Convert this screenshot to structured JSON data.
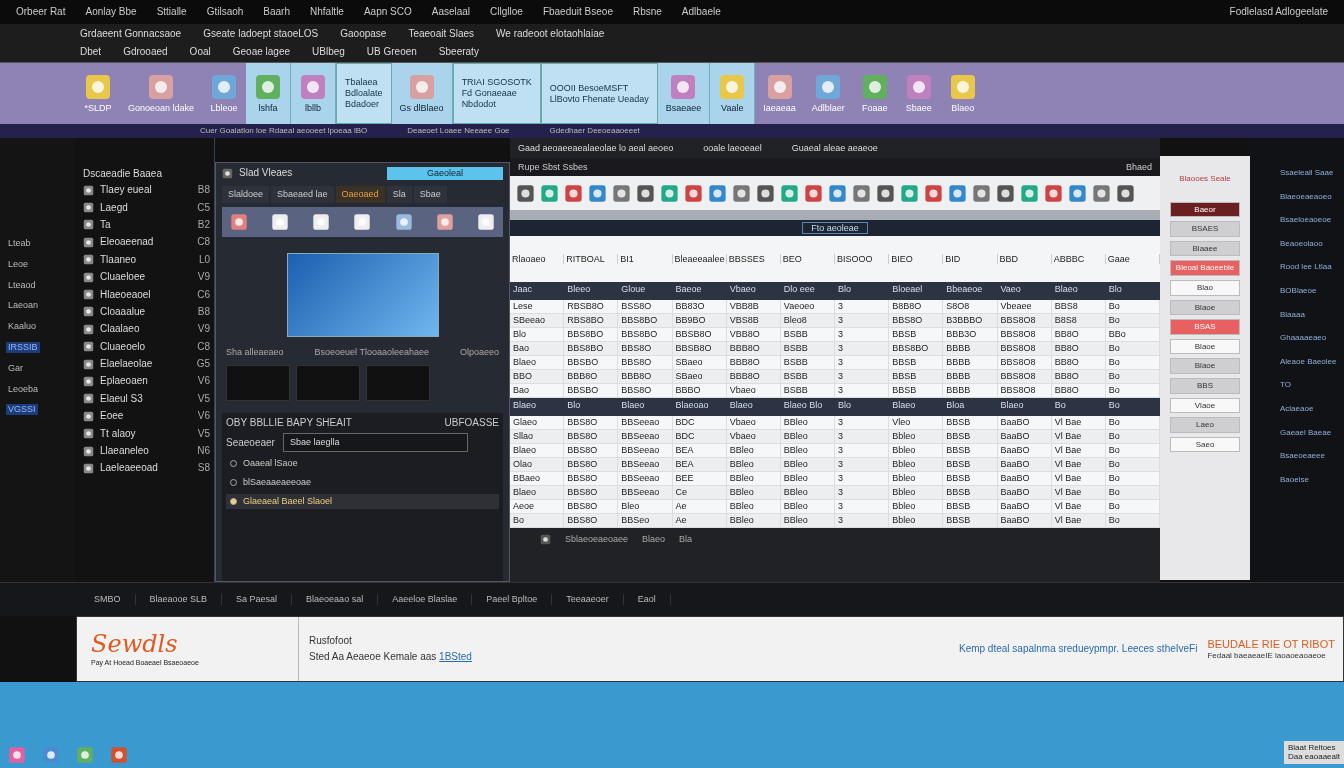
{
  "menu_bar": {
    "items": [
      "Orbeer Rat",
      "Aonlay Bbe",
      "Sttialle",
      "Gtilsaoh",
      "Baarh",
      "Nhfaltle",
      "Aapn SCO",
      "Aaselaal",
      "Cllglloe",
      "Fbaeduit Bseoe",
      "Rbsne",
      "Adlbaele"
    ],
    "right_text": "Fodlelasd Adlogeelate"
  },
  "toolbar": {
    "row_1": [
      "Grdaeent Gonnacsaoe",
      "Gseate ladoept staoeLOS",
      "Gaoopase",
      "Teaeoait Slaes",
      "We radeoot elotaohlaiae"
    ],
    "row_2": [
      "Dbet",
      "Gdrooaed",
      "Ooal",
      "Geoae lagee",
      "UBlbeg",
      "UB Greoen",
      "Sbeeraty"
    ]
  },
  "ribbon": {
    "items": [
      {
        "kind": "button",
        "highlighted": false,
        "label": "*SLDP"
      },
      {
        "kind": "button",
        "highlighted": false,
        "label": "Gonoeoan ldake"
      },
      {
        "kind": "button",
        "highlighted": false,
        "label": "Lbleoe"
      },
      {
        "kind": "button",
        "highlighted": true,
        "label": "lshfa"
      },
      {
        "kind": "button",
        "highlighted": true,
        "label": "lbllb"
      },
      {
        "kind": "note",
        "highlighted": true,
        "lines": [
          "Tbalaea",
          "Bdloalate",
          "Bdadoer"
        ]
      },
      {
        "kind": "button",
        "highlighted": true,
        "label": "Gs dlBlaeo"
      },
      {
        "kind": "note",
        "highlighted": true,
        "lines": [
          "TRIAI SGOSOTK",
          "Fd Gonaeaae",
          "Nbdodot"
        ]
      },
      {
        "kind": "note",
        "highlighted": true,
        "lines": [
          "OOOII BesoeMSFT",
          "LlBovto Fhenate Ueaday"
        ]
      },
      {
        "kind": "button",
        "highlighted": true,
        "label": "Bsaeaee"
      },
      {
        "kind": "button",
        "highlighted": true,
        "label": "Vaale"
      },
      {
        "kind": "button",
        "highlighted": false,
        "label": "Iaeaeaa"
      },
      {
        "kind": "button",
        "highlighted": false,
        "label": "Adlblaer"
      },
      {
        "kind": "button",
        "highlighted": false,
        "label": "Foaae"
      },
      {
        "kind": "button",
        "highlighted": false,
        "label": "Sbaee"
      },
      {
        "kind": "button",
        "highlighted": false,
        "label": "Blaeo"
      }
    ],
    "footer": [
      "Cuer Goalatlon loe Rdaeal aeooeet lpoeaa lBO",
      "Deaeoet Loaee Neeaee Goe",
      "Gdedhaer Deeoeaaoeeet"
    ]
  },
  "sidebar": {
    "items": [
      {
        "label": "Lteab",
        "selected": false
      },
      {
        "label": "Leoe",
        "selected": false
      },
      {
        "label": "Lteaod",
        "selected": false
      },
      {
        "label": "Laeoan",
        "selected": false
      },
      {
        "label": "Kaaluo",
        "selected": false
      },
      {
        "label": "IRSSIB",
        "selected": true
      },
      {
        "label": "Gar",
        "selected": false
      },
      {
        "label": "Leoeba",
        "selected": false
      },
      {
        "label": "VGSSI",
        "selected": true
      }
    ]
  },
  "file_list": {
    "header": "Dscaeadie Baaea",
    "items": [
      {
        "label": "Tlaey eueal",
        "code": "B8"
      },
      {
        "label": "Laegd",
        "code": "C5"
      },
      {
        "label": "Ta",
        "code": "B2"
      },
      {
        "label": "Eleoaeenad",
        "code": "C8"
      },
      {
        "label": "Tlaaneo",
        "code": "L0"
      },
      {
        "label": "Cluaeloee",
        "code": "V9"
      },
      {
        "label": "Hlaeoeaoel",
        "code": "C6"
      },
      {
        "label": "Cloaaalue",
        "code": "B8"
      },
      {
        "label": "Claalaeo",
        "code": "V9"
      },
      {
        "label": "Cluaeoelo",
        "code": "C8"
      },
      {
        "label": "Elaelaeolae",
        "code": "G5"
      },
      {
        "label": "Eplaeoaen",
        "code": "V6"
      },
      {
        "label": "Elaeul S3",
        "code": "V5"
      },
      {
        "label": "Eoee",
        "code": "V6"
      },
      {
        "label": "Tt alaoy",
        "code": "V5"
      },
      {
        "label": "Llaeaneleo",
        "code": "N6"
      },
      {
        "label": "Laeleaeeoad",
        "code": "S8"
      }
    ]
  },
  "dialog": {
    "title": "Slad Vleaes",
    "field": "Gaeoleal",
    "tabs": [
      {
        "label": "Slaldoee",
        "selected": false
      },
      {
        "label": "Sbaeaed lae",
        "selected": false
      },
      {
        "label": "Oaeoaed",
        "selected": true
      },
      {
        "label": "Sla",
        "selected": false
      },
      {
        "label": "Sbae",
        "selected": false
      }
    ],
    "caption": "Sha alleaeaeo",
    "info": "Bsoeoeuel Tlooaaoleeahaee",
    "info_right": "Olpoaeeo",
    "section_title": "OBY BBLLIE BAPY SHEAIT",
    "section_right": "UBFOASSE",
    "input_label": "Seaeoeaer",
    "input_value": "Sbae laeglla",
    "options": [
      {
        "label": "Oaaeal lSaoe",
        "selected": false
      },
      {
        "label": "blSaeaaeaeeoae",
        "selected": false
      },
      {
        "label": "Glaeaeal Baeel Slaoel",
        "selected": true
      }
    ]
  },
  "sheet": {
    "top_left": "Gaad aeoaeeaealaeolae lo aeal aeoeo",
    "top_mid": "ooale laeoeael",
    "top_right": "Guaeal aleae aeaeoe",
    "title": "Rupe Sbst Ssbes",
    "title_right": "Bhaed",
    "banner": "Fto aeoleae",
    "summary": [
      "Rlaoaeo",
      "RITBOAL",
      "BI1",
      "Bleaeeaalee",
      "BBSSES",
      "BEO",
      "BISOOO",
      "BIEO",
      "BID",
      "BBD",
      "ABBBC",
      "Gaae"
    ],
    "columns": [
      "Jaac",
      "Bleeo",
      "Gloue",
      "Baeoe",
      "Vbaeo",
      "Dlo eee",
      "Blo",
      "Bloeael",
      "Bbeaeoe",
      "Vaeo",
      "Blaeo",
      "Blo"
    ],
    "rows": [
      [
        "Lese",
        "RBSB8O",
        "BSS8O",
        "BB83O",
        "VBB8B",
        "Vaeoeo",
        "3",
        "B8B8O",
        "S8O8",
        "Vbeaee",
        "BBS8",
        "Bo"
      ],
      [
        "SBeeao",
        "RBS8BO",
        "BBS8BO",
        "BB9BO",
        "VBS8B",
        "Bleo8",
        "3",
        "BBS8O",
        "B3BBBO",
        "BBS8O8",
        "B8S8",
        "Bo"
      ],
      [
        "Blo",
        "BBS8BO",
        "BBS8BO",
        "BBSB8O",
        "VBB8O",
        "BSBB",
        "3",
        "BBSB",
        "BBB3O",
        "BBS8O8",
        "BB8O",
        "BBo"
      ],
      [
        "Bao",
        "BBS8BO",
        "BBS8O",
        "BBSB8O",
        "BBB8O",
        "BSBB",
        "3",
        "BBS8BO",
        "BBBB",
        "BBS8O8",
        "BB8O",
        "Bo"
      ],
      [
        "Blaeo",
        "BBSBO",
        "BBS8O",
        "SBaeo",
        "BBB8O",
        "BSBB",
        "3",
        "BBSB",
        "BBBB",
        "BBS8O8",
        "BB8O",
        "Bo"
      ],
      [
        "BBO",
        "BBB8O",
        "BBB8O",
        "SBaeo",
        "BBB8O",
        "BSBB",
        "3",
        "BBSB",
        "BBBB",
        "BBS8O8",
        "BB8O",
        "Bo"
      ],
      [
        "Bao",
        "BBSBO",
        "BBS8O",
        "BBBO",
        "Vbaeo",
        "BSBB",
        "3",
        "BBSB",
        "BBBB",
        "BBS8O8",
        "BB8O",
        "Bo"
      ]
    ],
    "subheader": [
      "Blaeo",
      "Blo",
      "Blaeo",
      "Blaeoao",
      "Blaeo",
      "Blaeo Blo",
      "Blo",
      "Blaeo",
      "Bloa",
      "Blaeo",
      "Bo",
      "Bo"
    ],
    "rows_2": [
      [
        "Glaeo",
        "BBS8O",
        "BBSeeao",
        "BDC",
        "Vbaeo",
        "BBleo",
        "3",
        "Vleo",
        "BBSB",
        "BaaBO",
        "Vl Bae",
        "Bo"
      ],
      [
        "Sllao",
        "BBS8O",
        "BBSeeao",
        "BDC",
        "Vbaeo",
        "BBleo",
        "3",
        "Bbleo",
        "BBSB",
        "BaaBO",
        "Vl Bae",
        "Bo"
      ],
      [
        "Blaeo",
        "BBS8O",
        "BBSeeao",
        "BEA",
        "BBleo",
        "BBleo",
        "3",
        "Bbleo",
        "BBSB",
        "BaaBO",
        "Vl Bae",
        "Bo"
      ],
      [
        "Olao",
        "BBS8O",
        "BBSeeao",
        "BEA",
        "BBleo",
        "BBleo",
        "3",
        "Bbleo",
        "BBSB",
        "BaaBO",
        "Vl Bae",
        "Bo"
      ],
      [
        "BBaeo",
        "BBS8O",
        "BBSeeao",
        "BEE",
        "BBleo",
        "BBleo",
        "3",
        "Bbleo",
        "BBSB",
        "BaaBO",
        "Vl Bae",
        "Bo"
      ],
      [
        "Blaeo",
        "BBS8O",
        "BBSeeao",
        "Ce",
        "BBleo",
        "BBleo",
        "3",
        "Bbleo",
        "BBSB",
        "BaaBO",
        "Vl Bae",
        "Bo"
      ],
      [
        "Aeoe",
        "BBS8O",
        "Bleo",
        "Ae",
        "BBleo",
        "BBleo",
        "3",
        "Bbleo",
        "BBSB",
        "BaaBO",
        "Vl Bae",
        "Bo"
      ],
      [
        "Bo",
        "BBS8O",
        "BBSeo",
        "Ae",
        "BBleo",
        "BBleo",
        "3",
        "Bbleo",
        "BBSB",
        "BaaBO",
        "Vl Bae",
        "Bo"
      ]
    ],
    "bottom_text": [
      "Sblaeoeaeoaee",
      "Blaeo",
      "Bla"
    ]
  },
  "right_panel": {
    "title": "Blaooes Seale",
    "buttons": [
      {
        "label": "Baeor",
        "color": "#6a2020"
      },
      {
        "label": "BSAES",
        "color": "#cfcfd2"
      },
      {
        "label": "Blaaee",
        "color": "#cfcfd2"
      },
      {
        "label": "Bleoal Baoeeble",
        "color": "#e86060"
      },
      {
        "label": "Blao",
        "color": "#f8f8f8"
      },
      {
        "label": "Blaoe",
        "color": "#cfcfd2"
      },
      {
        "label": "BSAS",
        "color": "#e86060"
      },
      {
        "label": "Blaoe",
        "color": "#f8f8f8"
      },
      {
        "label": "Blaoe",
        "color": "#cfcfd2"
      },
      {
        "label": "BBS",
        "color": "#cfcfd2"
      },
      {
        "label": "Vlaoe",
        "color": "#f8f8f8"
      },
      {
        "label": "Laeo",
        "color": "#cfcfd2"
      },
      {
        "label": "Saeo",
        "color": "#f8f8f8"
      }
    ]
  },
  "far_right": {
    "items": [
      "Ssaeleall Saae",
      "Blaeoeaeaoeo",
      "Bsaeloeaoeoe",
      "Beaoeolaoo",
      "Rood lee Ltlaa",
      "BOBlaeoe",
      "Blaaaa",
      "Ghaaaaeaeo",
      "Aleaoe Baeolee",
      "TO",
      "Aclaeaoe",
      "Gaeael Baeae",
      "Bsaeoeaeee",
      "Baoelse"
    ]
  },
  "status_bar": [
    "SMBO",
    "Blaeaooe SLB",
    "Sa Paesal",
    "Blaeoeaao sal",
    "Aaeeloe Blaslae",
    "Paeel Bpltoe",
    "Teeaaeoer",
    "Eaol"
  ],
  "banner": {
    "logo": "Sewdls",
    "logo_sub": "Pay At Hoead Boaeael Bsaeoaeoe",
    "title": "Rusfofoot",
    "text": "Sted Aa Aeaeoe Kemale aas",
    "link": "1BSted",
    "center_link": "Kemp dteal sapalnma sredueypmpr. Leeces stheIveFi",
    "right_title": "BEUDALE RIE OT RIBOT",
    "right_sub": "Fedaal baeaeaeIE laoaoeaoaeoe"
  },
  "taskbar": {
    "tray": [
      "Blaat Reltoes",
      "Daa eaoaaealt"
    ]
  }
}
